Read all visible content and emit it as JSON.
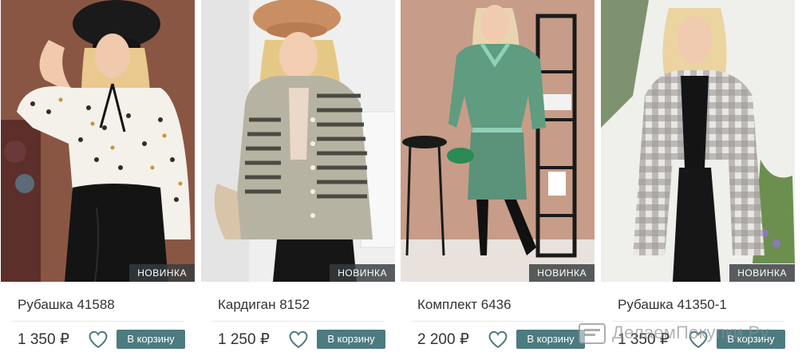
{
  "products": [
    {
      "badge": "НОВИНКА",
      "title": "Рубашка 41588",
      "price": "1 350 ₽",
      "cart_label": "В корзину",
      "favorite_icon": "heart-icon"
    },
    {
      "badge": "НОВИНКА",
      "title": "Кардиган 8152",
      "price": "1 250 ₽",
      "cart_label": "В корзину",
      "favorite_icon": "heart-icon"
    },
    {
      "badge": "НОВИНКА",
      "title": "Комплект 6436",
      "price": "2 200 ₽",
      "cart_label": "В корзину",
      "favorite_icon": "heart-icon"
    },
    {
      "badge": "НОВИНКА",
      "title": "Рубашка 41350-1",
      "price": "1 350 ₽",
      "cart_label": "В корзину",
      "favorite_icon": "heart-icon"
    }
  ],
  "watermark": {
    "text": "ДелаемПокупки.Ру",
    "icon": "cart-logo-icon"
  },
  "colors": {
    "cart_button": "#4c7b80",
    "badge": "#373c3e",
    "text": "#333333"
  }
}
